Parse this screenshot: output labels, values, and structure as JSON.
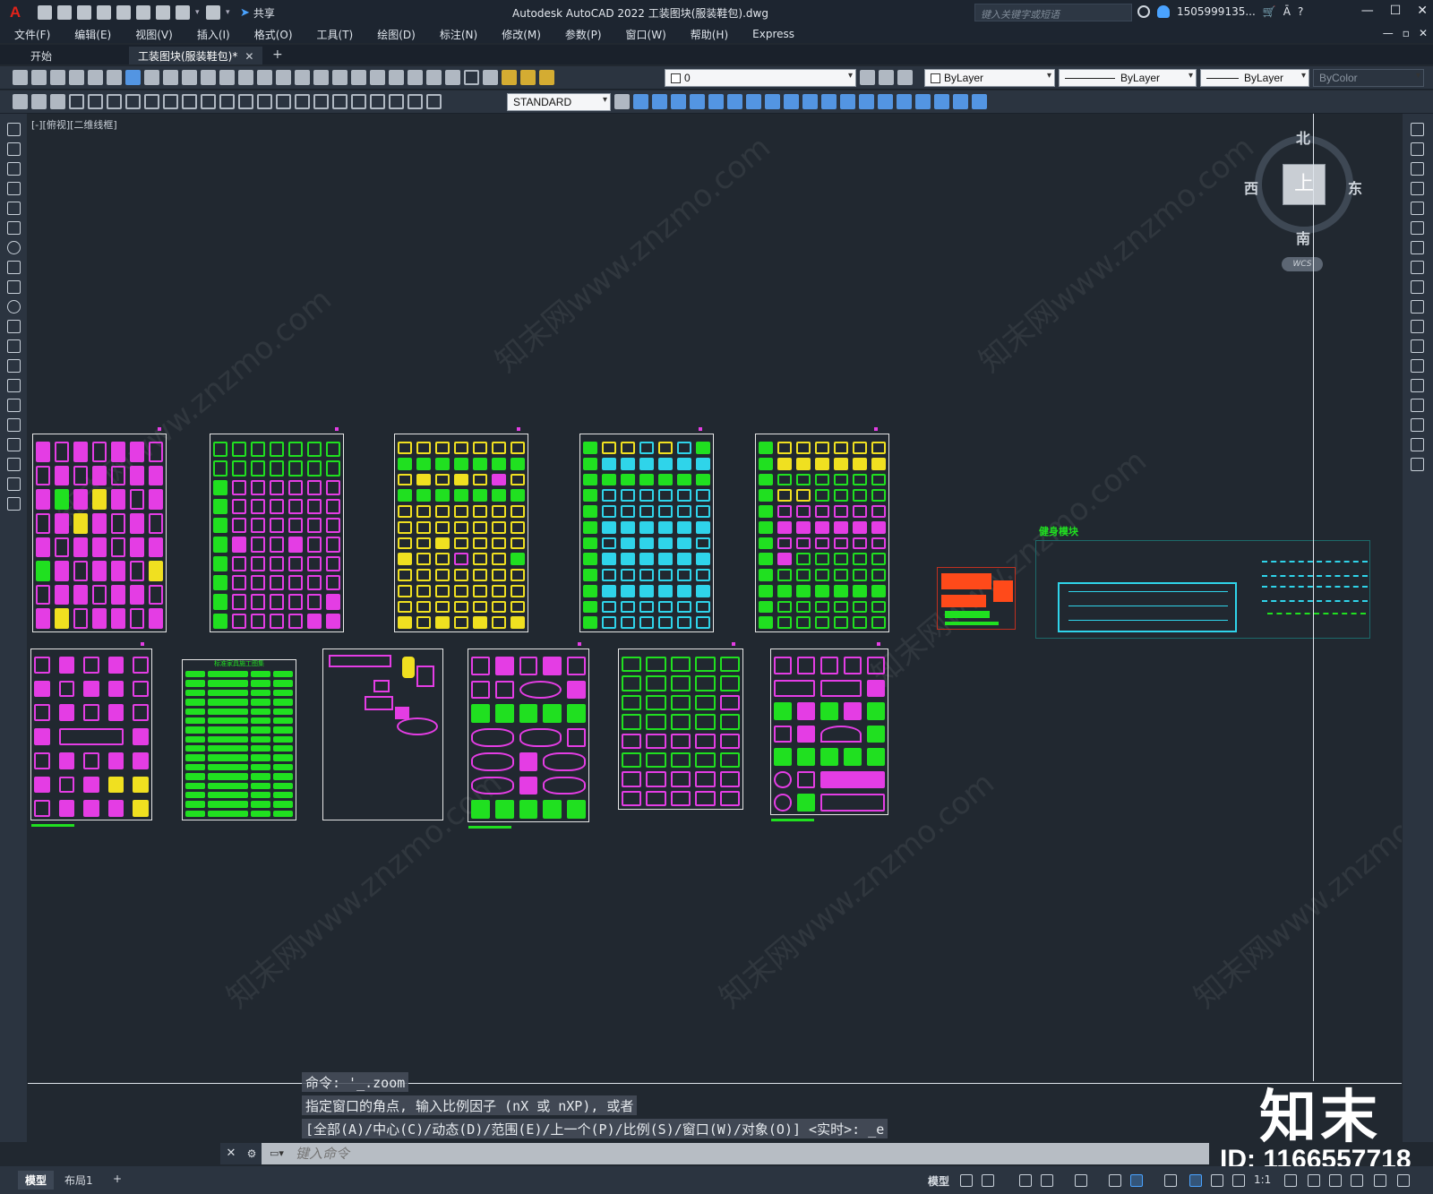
{
  "titlebar": {
    "app_logo": "A",
    "share_label": "共享",
    "window_title": "Autodesk AutoCAD 2022    工装图块(服装鞋包).dwg",
    "search_placeholder": "键入关键字或短语",
    "user": "1505999135...",
    "window_controls": [
      "—",
      "☐",
      "✕"
    ]
  },
  "menu": {
    "items": [
      "文件(F)",
      "编辑(E)",
      "视图(V)",
      "插入(I)",
      "格式(O)",
      "工具(T)",
      "绘图(D)",
      "标注(N)",
      "修改(M)",
      "参数(P)",
      "窗口(W)",
      "帮助(H)",
      "Express"
    ],
    "doc_controls": [
      "—",
      "▫",
      "✕"
    ]
  },
  "tabs": {
    "start": "开始",
    "active": "工装图块(服装鞋包)*",
    "close": "✕",
    "add": "+"
  },
  "toolbar": {
    "layer_value": "0",
    "color_value": "ByLayer",
    "linetype_value": "ByLayer",
    "lineweight_value": "ByLayer",
    "plotstyle_value": "ByColor",
    "textstyle_value": "STANDARD"
  },
  "viewport": {
    "label": "[-][俯视][二维线框]"
  },
  "viewcube": {
    "north": "北",
    "south": "南",
    "east": "东",
    "west": "西",
    "top": "上",
    "wcs": "WCS"
  },
  "drawing": {
    "table_sheet_title": "标准家具施工图集",
    "fitness_label": "健身模块"
  },
  "command": {
    "history": [
      "命令: '_.zoom",
      "指定窗口的角点, 输入比例因子 (nX 或 nXP), 或者",
      "[全部(A)/中心(C)/动态(D)/范围(E)/上一个(P)/比例(S)/窗口(W)/对象(O)] <实时>: _e"
    ],
    "placeholder": "键入命令"
  },
  "status": {
    "layout_tabs": [
      "模型",
      "布局1"
    ],
    "add_layout": "+",
    "model_label": "模型",
    "scale": "1:1"
  },
  "watermark": {
    "text": "知末网www.znzmo.com",
    "logo": "知末",
    "id": "ID: 1166557718"
  }
}
